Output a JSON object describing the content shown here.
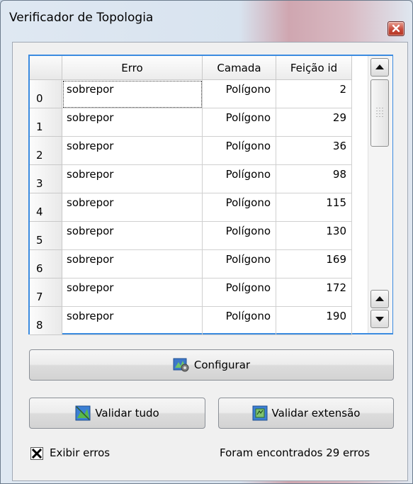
{
  "window": {
    "title": "Verificador de Topologia",
    "close_label": "×"
  },
  "table": {
    "columns": [
      "Erro",
      "Camada",
      "Feição id"
    ],
    "rows": [
      {
        "index": "0",
        "erro": "sobrepor",
        "camada": "Polígono",
        "feicao_id": "2"
      },
      {
        "index": "1",
        "erro": "sobrepor",
        "camada": "Polígono",
        "feicao_id": "29"
      },
      {
        "index": "2",
        "erro": "sobrepor",
        "camada": "Polígono",
        "feicao_id": "36"
      },
      {
        "index": "3",
        "erro": "sobrepor",
        "camada": "Polígono",
        "feicao_id": "98"
      },
      {
        "index": "4",
        "erro": "sobrepor",
        "camada": "Polígono",
        "feicao_id": "115"
      },
      {
        "index": "5",
        "erro": "sobrepor",
        "camada": "Polígono",
        "feicao_id": "130"
      },
      {
        "index": "6",
        "erro": "sobrepor",
        "camada": "Polígono",
        "feicao_id": "169"
      },
      {
        "index": "7",
        "erro": "sobrepor",
        "camada": "Polígono",
        "feicao_id": "172"
      },
      {
        "index": "8",
        "erro": "sobrepor",
        "camada": "Polígono",
        "feicao_id": "190"
      }
    ]
  },
  "buttons": {
    "configure": "Configurar",
    "validate_all": "Validar tudo",
    "validate_extent": "Validar extensão"
  },
  "options": {
    "show_errors_label": "Exibir erros",
    "show_errors_checked": true
  },
  "status": {
    "text": "Foram encontrados 29 erros"
  },
  "icons": [
    "close-icon",
    "configure-icon",
    "validate-all-icon",
    "validate-extent-icon",
    "checkbox-check-icon",
    "scroll-up-icon",
    "scroll-down-icon"
  ],
  "colors": {
    "table_focus_border": "#3b8be0",
    "close_button": "#c8493a"
  }
}
